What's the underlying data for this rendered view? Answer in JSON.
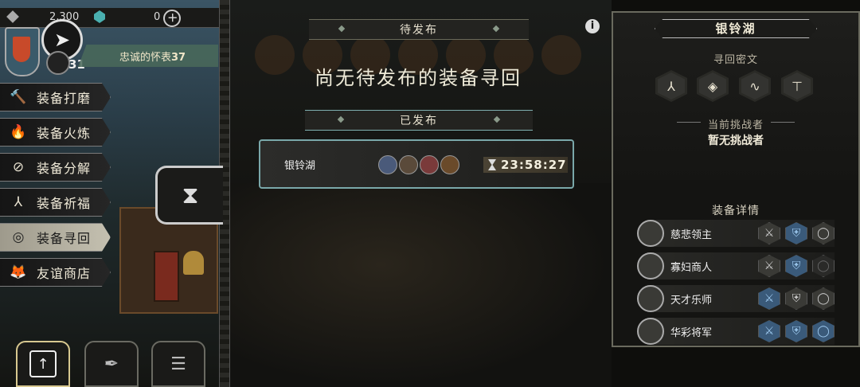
{
  "topbar": {
    "currency1": "2,300",
    "currency2": "0"
  },
  "profile": {
    "level": "31",
    "title_prefix": "忠诚的怀表",
    "title_num": "37"
  },
  "menu": [
    {
      "label": "装备打磨",
      "icon": "hammer-icon",
      "glyph": "🔨"
    },
    {
      "label": "装备火炼",
      "icon": "flame-icon",
      "glyph": "🔥"
    },
    {
      "label": "装备分解",
      "icon": "split-icon",
      "glyph": "⊘"
    },
    {
      "label": "装备祈福",
      "icon": "hands-icon",
      "glyph": "⅄"
    },
    {
      "label": "装备寻回",
      "icon": "retrieve-icon",
      "glyph": "◎",
      "active": true
    },
    {
      "label": "友谊商店",
      "icon": "fox-icon",
      "glyph": "🦊"
    }
  ],
  "pending": {
    "header": "待发布",
    "empty_text": "尚无待发布的装备寻回"
  },
  "published": {
    "header": "已发布"
  },
  "quest": {
    "name": "银铃湖",
    "timer": "23:58:27"
  },
  "right": {
    "location": "银铃湖",
    "runes_label": "寻回密文",
    "runes": [
      "⅄",
      "◈",
      "∿",
      "⊤"
    ],
    "challenger_label": "当前挑战者",
    "challenger_value": "暂无挑战者",
    "details_label": "装备详情",
    "equipment": [
      {
        "name": "慈悲领主",
        "slots": [
          "grey",
          "blue",
          "grey"
        ]
      },
      {
        "name": "寡妇商人",
        "slots": [
          "grey",
          "blue",
          "empty"
        ]
      },
      {
        "name": "天才乐师",
        "slots": [
          "blue",
          "grey",
          "grey"
        ]
      },
      {
        "name": "华彩将军",
        "slots": [
          "blue",
          "blue",
          "blue"
        ]
      }
    ]
  },
  "colors": {
    "accent_teal": "#7aa8aa",
    "slot_blue": "#3a5a7a"
  }
}
